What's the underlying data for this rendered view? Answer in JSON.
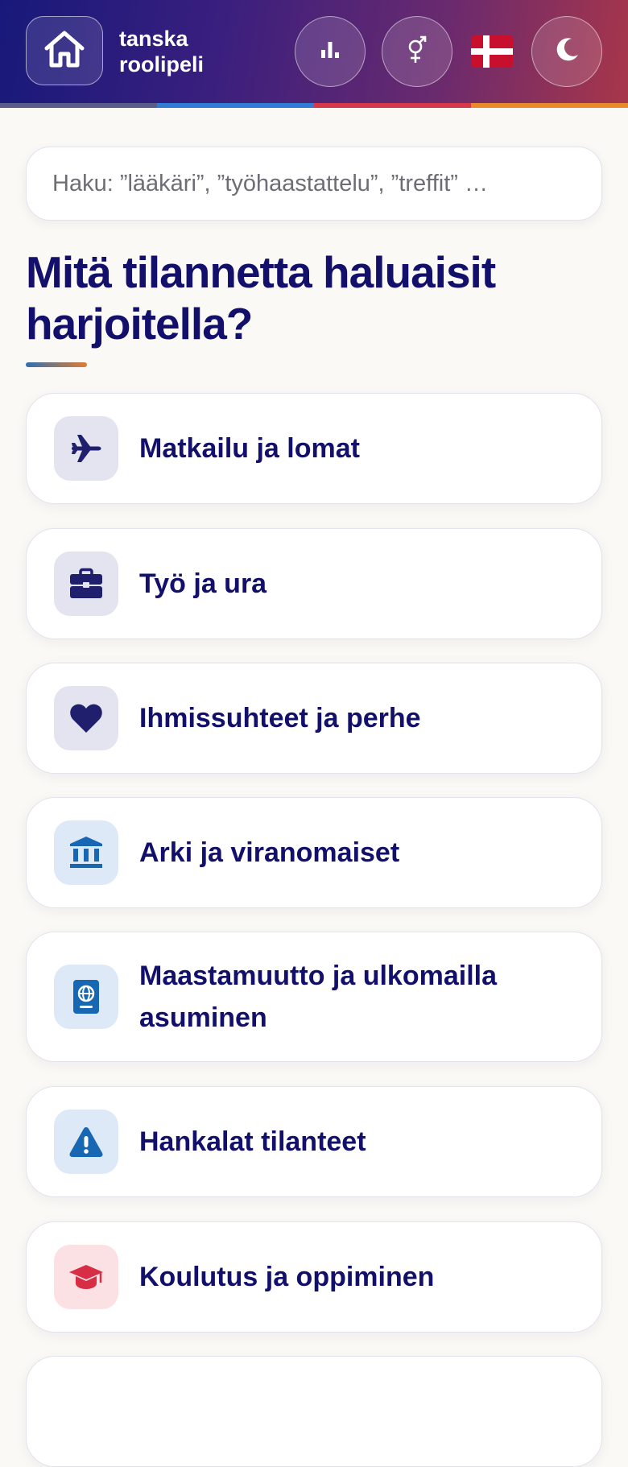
{
  "header": {
    "brand_line1": "tanska",
    "brand_line2": "roolipeli",
    "home_icon": "home-icon",
    "stats_icon": "bar-chart-icon",
    "gender_icon": "gender-icon",
    "flag_icon": "denmark-flag-icon",
    "theme_icon": "moon-icon",
    "stripe_colors": [
      "#5a5d8a",
      "#2f7dd4",
      "#d8394a",
      "#e98a2c"
    ]
  },
  "search": {
    "placeholder": "Haku: ”lääkäri”, ”työhaastattelu”, ”treffit” …"
  },
  "main": {
    "title": "Mitä tilannetta haluaisit harjoitella?"
  },
  "categories": [
    {
      "label": "Matkailu ja lomat",
      "icon": "airplane-icon",
      "icon_bg": "#e4e3f0",
      "icon_color": "#1f1f6e"
    },
    {
      "label": "Työ ja ura",
      "icon": "briefcase-icon",
      "icon_bg": "#e4e3f0",
      "icon_color": "#1f1f6e"
    },
    {
      "label": "Ihmissuhteet ja perhe",
      "icon": "heart-icon",
      "icon_bg": "#e4e3f0",
      "icon_color": "#1f1f6e"
    },
    {
      "label": "Arki ja viranomaiset",
      "icon": "bank-icon",
      "icon_bg": "#dde9f6",
      "icon_color": "#1767b3"
    },
    {
      "label": "Maastamuutto ja ulkomailla asuminen",
      "icon": "passport-icon",
      "icon_bg": "#dde9f6",
      "icon_color": "#1767b3"
    },
    {
      "label": "Hankalat tilanteet",
      "icon": "warning-icon",
      "icon_bg": "#dde9f6",
      "icon_color": "#1767b3"
    },
    {
      "label": "Koulutus ja oppiminen",
      "icon": "graduation-cap-icon",
      "icon_bg": "#fbe0e4",
      "icon_color": "#d72d45"
    }
  ]
}
